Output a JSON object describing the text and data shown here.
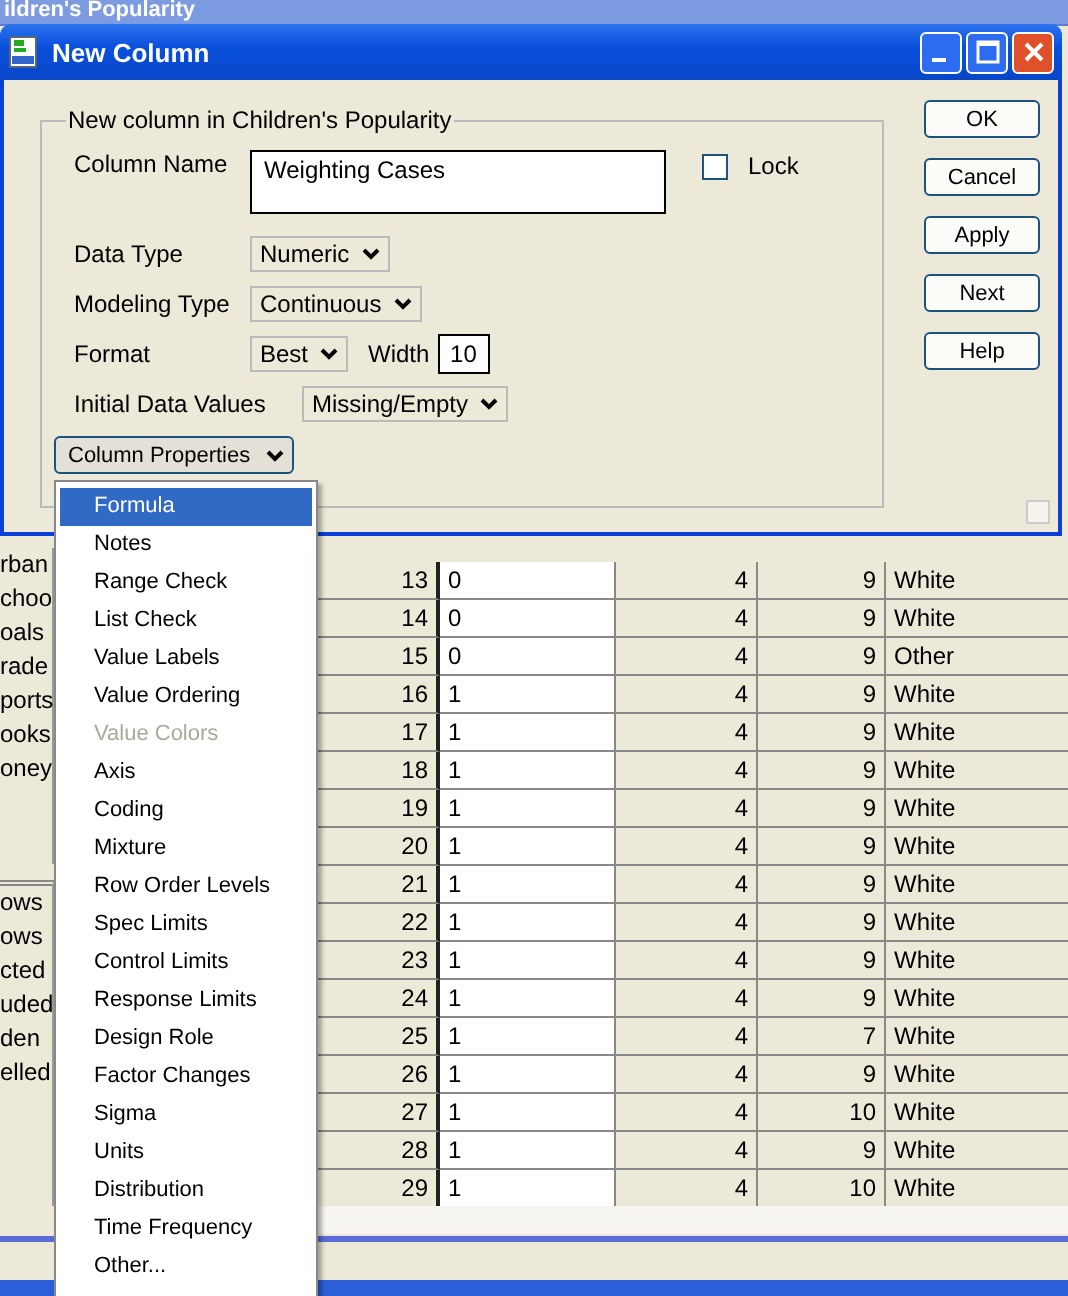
{
  "background_window": {
    "title": "ildren's Popularity",
    "columns_panel": [
      "rban",
      "choo",
      "oals",
      "rade",
      "ports",
      "ooks",
      "oney"
    ],
    "rows_panel": [
      "ows",
      "ows",
      "cted",
      "uded",
      "den",
      "elled"
    ],
    "table_rows": [
      [
        "13",
        "0",
        "4",
        "9",
        "White"
      ],
      [
        "14",
        "0",
        "4",
        "9",
        "White"
      ],
      [
        "15",
        "0",
        "4",
        "9",
        "Other"
      ],
      [
        "16",
        "1",
        "4",
        "9",
        "White"
      ],
      [
        "17",
        "1",
        "4",
        "9",
        "White"
      ],
      [
        "18",
        "1",
        "4",
        "9",
        "White"
      ],
      [
        "19",
        "1",
        "4",
        "9",
        "White"
      ],
      [
        "20",
        "1",
        "4",
        "9",
        "White"
      ],
      [
        "21",
        "1",
        "4",
        "9",
        "White"
      ],
      [
        "22",
        "1",
        "4",
        "9",
        "White"
      ],
      [
        "23",
        "1",
        "4",
        "9",
        "White"
      ],
      [
        "24",
        "1",
        "4",
        "9",
        "White"
      ],
      [
        "25",
        "1",
        "4",
        "7",
        "White"
      ],
      [
        "26",
        "1",
        "4",
        "9",
        "White"
      ],
      [
        "27",
        "1",
        "4",
        "10",
        "White"
      ],
      [
        "28",
        "1",
        "4",
        "9",
        "White"
      ],
      [
        "29",
        "1",
        "4",
        "10",
        "White"
      ]
    ]
  },
  "dialog": {
    "title": "New Column",
    "group_title": "New column in Children's Popularity",
    "column_name": {
      "label": "Column Name",
      "value": "Weighting Cases"
    },
    "lock": {
      "label": "Lock",
      "checked": false
    },
    "data_type": {
      "label": "Data Type",
      "value": "Numeric"
    },
    "modeling_type": {
      "label": "Modeling Type",
      "value": "Continuous"
    },
    "format": {
      "label": "Format",
      "value": "Best",
      "width_label": "Width",
      "width_value": "10"
    },
    "initial_data_values": {
      "label": "Initial Data Values",
      "value": "Missing/Empty"
    },
    "column_properties": {
      "label": "Column Properties",
      "expanded": true
    },
    "buttons": [
      "OK",
      "Cancel",
      "Apply",
      "Next",
      "Help"
    ]
  },
  "column_properties_menu": [
    {
      "label": "Formula",
      "selected": true,
      "disabled": false
    },
    {
      "label": "Notes",
      "selected": false,
      "disabled": false
    },
    {
      "label": "Range Check",
      "selected": false,
      "disabled": false
    },
    {
      "label": "List Check",
      "selected": false,
      "disabled": false
    },
    {
      "label": "Value Labels",
      "selected": false,
      "disabled": false
    },
    {
      "label": "Value Ordering",
      "selected": false,
      "disabled": false
    },
    {
      "label": "Value Colors",
      "selected": false,
      "disabled": true
    },
    {
      "label": "Axis",
      "selected": false,
      "disabled": false
    },
    {
      "label": "Coding",
      "selected": false,
      "disabled": false
    },
    {
      "label": "Mixture",
      "selected": false,
      "disabled": false
    },
    {
      "label": "Row Order Levels",
      "selected": false,
      "disabled": false
    },
    {
      "label": "Spec Limits",
      "selected": false,
      "disabled": false
    },
    {
      "label": "Control Limits",
      "selected": false,
      "disabled": false
    },
    {
      "label": "Response Limits",
      "selected": false,
      "disabled": false
    },
    {
      "label": "Design Role",
      "selected": false,
      "disabled": false
    },
    {
      "label": "Factor Changes",
      "selected": false,
      "disabled": false
    },
    {
      "label": "Sigma",
      "selected": false,
      "disabled": false
    },
    {
      "label": "Units",
      "selected": false,
      "disabled": false
    },
    {
      "label": "Distribution",
      "selected": false,
      "disabled": false
    },
    {
      "label": "Time Frequency",
      "selected": false,
      "disabled": false
    },
    {
      "label": "Other...",
      "selected": false,
      "disabled": false
    }
  ]
}
